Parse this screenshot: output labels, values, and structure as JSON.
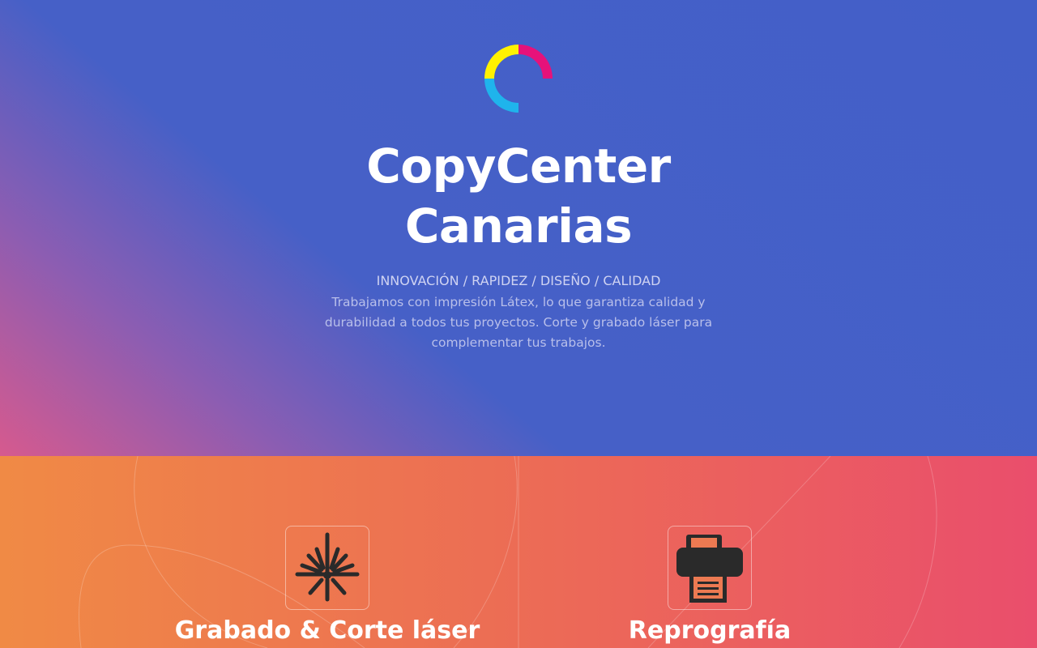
{
  "hero": {
    "logo_icon": "cmyk-ring-logo-icon",
    "title_line1": "CopyCenter",
    "title_line2": "Canarias",
    "tagline": "INNOVACIÓN / RAPIDEZ / DISEÑO / CALIDAD",
    "description": "Trabajamos con impresión Látex, lo que garantiza calidad y durabilidad a todos tus proyectos. Corte y grabado láser para complementar tus trabajos.",
    "colors": {
      "background": "#435fc8",
      "accent_pink": "#d65a8e"
    }
  },
  "services": {
    "colors": {
      "gradient_start": "#f08a45",
      "gradient_end": "#ea4e6c"
    },
    "items": [
      {
        "icon": "laser-icon",
        "title": "Grabado & Corte láser"
      },
      {
        "icon": "printer-icon",
        "title": "Reprografía"
      }
    ]
  }
}
